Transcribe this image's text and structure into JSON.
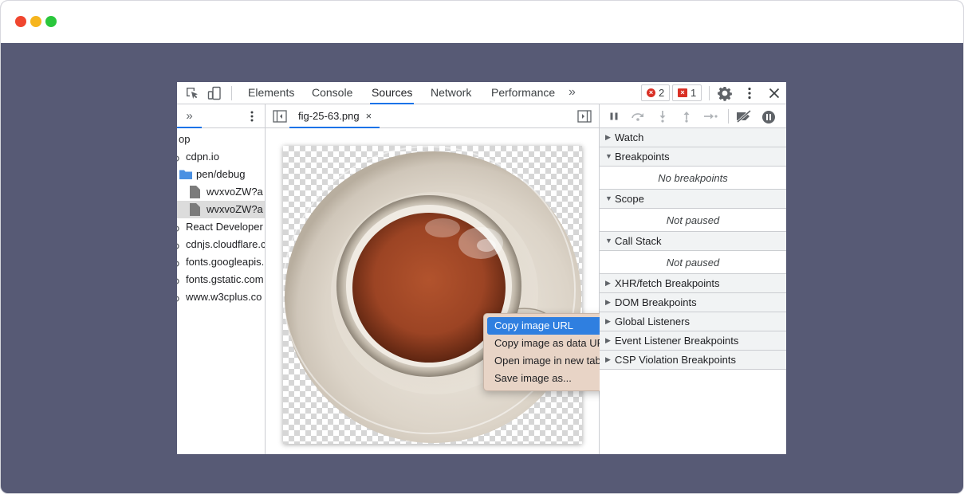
{
  "toolbar": {
    "tabs": [
      "Elements",
      "Console",
      "Sources",
      "Network",
      "Performance"
    ],
    "active_tab": "Sources",
    "more_tabs_glyph": "»",
    "error_count": "2",
    "issue_count": "1",
    "icons": [
      "inspect-element-icon",
      "device-toolbar-icon",
      "gear-icon",
      "kebab-menu-icon",
      "close-icon"
    ]
  },
  "navigator": {
    "more_glyph": "»",
    "tree": [
      {
        "label": "top",
        "shown": "op",
        "indent": 0,
        "icon": "none"
      },
      {
        "label": "cdpn.io",
        "indent": 1,
        "icon": "cloud-icon"
      },
      {
        "label": "pen/debug",
        "indent": 2,
        "icon": "folder-icon"
      },
      {
        "label": "wvxvoZW?a",
        "indent": 3,
        "icon": "file-icon"
      },
      {
        "label": "wvxvoZW?a",
        "indent": 3,
        "icon": "file-icon",
        "selected": true
      },
      {
        "label": "React Developer",
        "indent": 1,
        "icon": "cloud-icon"
      },
      {
        "label": "cdnjs.cloudflare.c",
        "indent": 1,
        "icon": "cloud-icon"
      },
      {
        "label": "fonts.googleapis.",
        "indent": 1,
        "icon": "cloud-icon"
      },
      {
        "label": "fonts.gstatic.com",
        "indent": 1,
        "icon": "cloud-icon"
      },
      {
        "label": "www.w3cplus.co",
        "indent": 1,
        "icon": "cloud-icon"
      }
    ]
  },
  "editor": {
    "file_tab": "fig-25-63.png",
    "close_glyph": "×",
    "image_subject": "coffee cup on saucer"
  },
  "context_menu": {
    "items": [
      "Copy image URL",
      "Copy image as data URI",
      "Open image in new tab",
      "Save image as..."
    ],
    "highlighted": "Copy image URL"
  },
  "debugger": {
    "toolbar_icons": [
      "pause-icon",
      "step-over-icon",
      "step-into-icon",
      "step-out-icon",
      "step-icon",
      "deactivate-breakpoints-icon",
      "pause-on-exceptions-icon"
    ],
    "panes": [
      {
        "label": "Watch",
        "expanded": false
      },
      {
        "label": "Breakpoints",
        "expanded": true,
        "body": "No breakpoints"
      },
      {
        "label": "Scope",
        "expanded": true,
        "body": "Not paused"
      },
      {
        "label": "Call Stack",
        "expanded": true,
        "body": "Not paused"
      },
      {
        "label": "XHR/fetch Breakpoints",
        "expanded": false
      },
      {
        "label": "DOM Breakpoints",
        "expanded": false
      },
      {
        "label": "Global Listeners",
        "expanded": false
      },
      {
        "label": "Event Listener Breakpoints",
        "expanded": false
      },
      {
        "label": "CSP Violation Breakpoints",
        "expanded": false
      }
    ]
  },
  "colors": {
    "accent": "#1a73e8",
    "error": "#d93025",
    "backdrop": "#575a75",
    "menu_highlight": "#2f7fe0"
  }
}
